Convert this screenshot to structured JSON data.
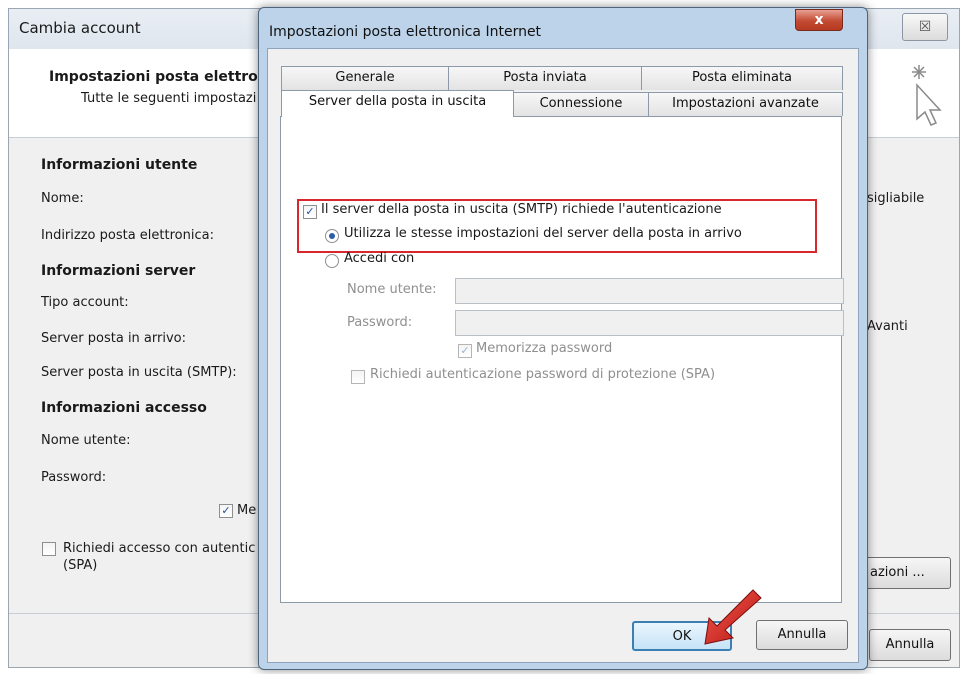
{
  "background_dialog": {
    "title": "Cambia account",
    "close_glyph": "☒",
    "header_title": "Impostazioni posta elettro",
    "header_subtitle": "Tutte le seguenti impostazi",
    "user_info_section": "Informazioni utente",
    "name_label": "Nome:",
    "email_label": "Indirizzo posta elettronica:",
    "server_info_section": "Informazioni server",
    "account_type_label": "Tipo account:",
    "incoming_label": "Server posta in arrivo:",
    "outgoing_label": "Server posta in uscita (SMTP):",
    "login_section": "Informazioni accesso",
    "username_label": "Nome utente:",
    "password_label": "Password:",
    "remember_partial": "Me",
    "spa_label_line1": "Richiedi accesso con autentic",
    "spa_label_line2": "(SPA)",
    "right_text_1": "sigliabile",
    "right_text_2": "Avanti",
    "more_settings_button": "azioni ...",
    "cancel_button": "Annulla"
  },
  "dialog": {
    "title": "Impostazioni posta elettronica Internet",
    "close_glyph": "x",
    "tabs_row1": [
      "Generale",
      "Posta inviata",
      "Posta eliminata"
    ],
    "tabs_row2": [
      "Server della posta in uscita",
      "Connessione",
      "Impostazioni avanzate"
    ],
    "active_tab": "Server della posta in uscita",
    "smtp_auth_label": "Il server della posta in uscita (SMTP) richiede l'autenticazione",
    "smtp_auth_checked": true,
    "same_settings_label": "Utilizza le stesse impostazioni del server della posta in arrivo",
    "login_with_label": "Accedi con",
    "username_label": "Nome utente:",
    "password_label": "Password:",
    "remember_password_label": "Memorizza password",
    "spa_label": "Richiedi autenticazione password di protezione (SPA)",
    "ok_button": "OK",
    "cancel_button": "Annulla"
  },
  "colors": {
    "highlight_box": "#d8282e",
    "annotation_arrow": "#d42020",
    "close_button": "#c34a33"
  }
}
